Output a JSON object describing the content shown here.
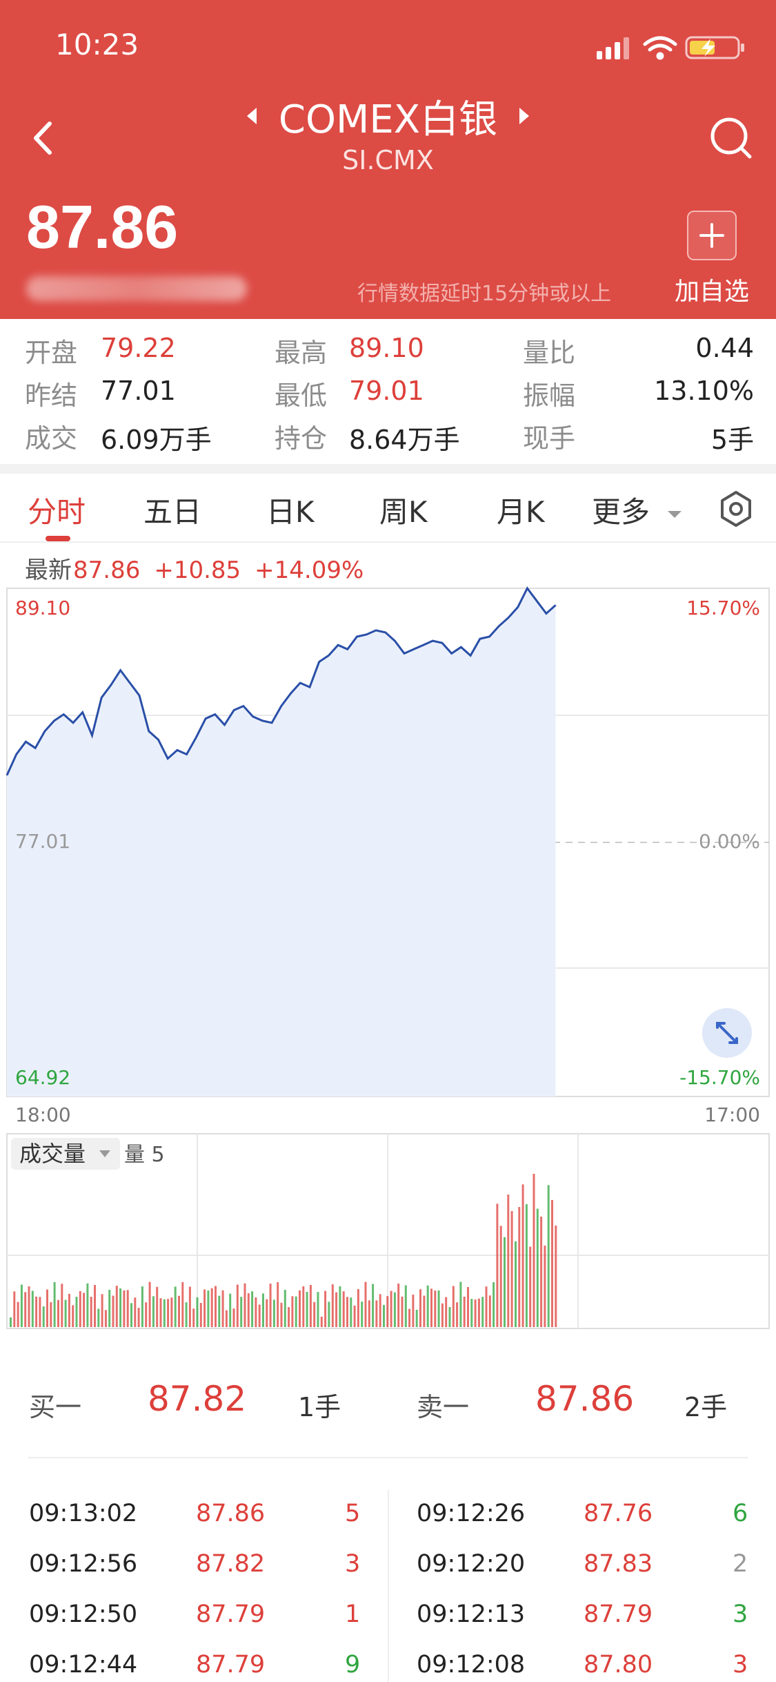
{
  "status_bar": {
    "time": "10:23"
  },
  "header": {
    "title": "COMEX白银",
    "code": "SI.CMX",
    "price": "87.86",
    "delay_note": "行情数据延时15分钟或以上",
    "add_label": "加自选",
    "accent": "#dd4b45"
  },
  "stats": {
    "open_label": "开盘",
    "open": "79.22",
    "high_label": "最高",
    "high": "89.10",
    "ratio_label": "量比",
    "ratio": "0.44",
    "prev_label": "昨结",
    "prev": "77.01",
    "low_label": "最低",
    "low": "79.01",
    "amp_label": "振幅",
    "amp": "13.10%",
    "vol_label": "成交",
    "vol": "6.09万手",
    "oi_label": "持仓",
    "oi": "8.64万手",
    "cur_label": "现手",
    "cur": "5手"
  },
  "tabs": [
    "分时",
    "五日",
    "日K",
    "周K",
    "月K",
    "更多"
  ],
  "latest": {
    "label": "最新",
    "price": "87.86",
    "change": "+10.85",
    "pct": "+14.09%"
  },
  "chart_data": {
    "type": "line",
    "y_axis_left": [
      "89.10",
      "77.01",
      "64.92"
    ],
    "y_axis_right": [
      "15.70%",
      "0.00%",
      "-15.70%"
    ],
    "x_labels": [
      "18:00",
      "17:00"
    ],
    "ylim": [
      64.92,
      89.1
    ],
    "reference": 77.01,
    "x_fraction_covered": 0.72,
    "series": [
      {
        "values": [
          80.2,
          81.2,
          81.8,
          81.5,
          82.3,
          82.8,
          83.1,
          82.7,
          83.2,
          82.1,
          83.9,
          84.5,
          85.2,
          84.6,
          84.0,
          82.3,
          81.9,
          81.0,
          81.4,
          81.2,
          82.0,
          82.9,
          83.1,
          82.6,
          83.3,
          83.5,
          83.0,
          82.8,
          82.7,
          83.5,
          84.1,
          84.6,
          84.4,
          85.6,
          85.9,
          86.4,
          86.2,
          86.8,
          86.9,
          87.1,
          87.0,
          86.6,
          86.0,
          86.2,
          86.4,
          86.6,
          86.5,
          86.0,
          86.3,
          85.9,
          86.7,
          86.8,
          87.3,
          87.7,
          88.2,
          89.1,
          88.5,
          87.9,
          88.3
        ]
      }
    ],
    "volume_label": "成交量",
    "volume_value_label": "量 5",
    "up_color": "#dd3f3a",
    "down_color": "#2fa53f",
    "line_color": "#2a4fa8"
  },
  "quote": {
    "buy_label": "买一",
    "buy_price": "87.82",
    "buy_qty": "1手",
    "sell_label": "卖一",
    "sell_price": "87.86",
    "sell_qty": "2手"
  },
  "trades_left": [
    {
      "time": "09:13:02",
      "price": "87.86",
      "qty": "5",
      "dir": "up"
    },
    {
      "time": "09:12:56",
      "price": "87.82",
      "qty": "3",
      "dir": "up"
    },
    {
      "time": "09:12:50",
      "price": "87.79",
      "qty": "1",
      "dir": "up"
    },
    {
      "time": "09:12:44",
      "price": "87.79",
      "qty": "9",
      "dir": "down"
    }
  ],
  "trades_right": [
    {
      "time": "09:12:26",
      "price": "87.76",
      "qty": "6",
      "dir": "down"
    },
    {
      "time": "09:12:20",
      "price": "87.83",
      "qty": "2",
      "dir": "flat"
    },
    {
      "time": "09:12:13",
      "price": "87.79",
      "qty": "3",
      "dir": "down"
    },
    {
      "time": "09:12:08",
      "price": "87.80",
      "qty": "3",
      "dir": "up"
    }
  ]
}
